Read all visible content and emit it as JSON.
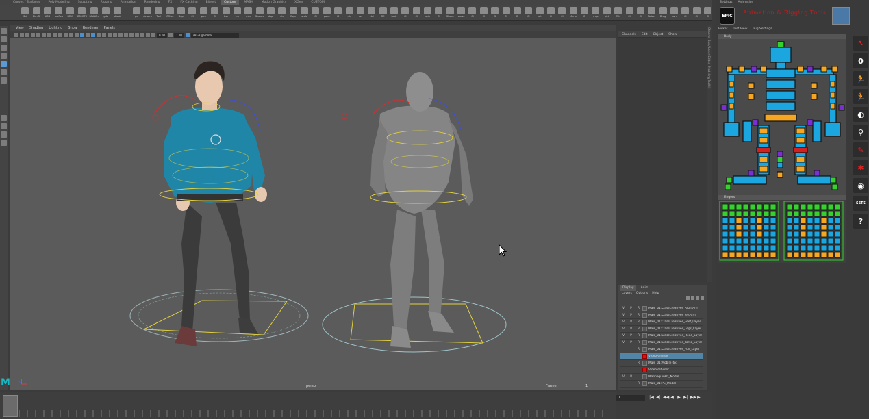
{
  "shelf_tabs": [
    "Curves / Surfaces",
    "Poly Modeling",
    "Sculpting",
    "Rigging",
    "Animation",
    "Rendering",
    "FX",
    "FX Caching",
    "Bifrost",
    "Custom",
    "MASH",
    "Motion Graphics",
    "XGen",
    "CUSTOM"
  ],
  "shelf_active_tab": "Custom",
  "shelf_group1": [
    "Sel",
    "BkmR",
    "U3D",
    "butRes",
    "BRX",
    "SMOOTH",
    "SCALEm",
    "gde",
    "bRest"
  ],
  "shelf_group2": [
    "ge",
    "deform",
    "Tool",
    "Offset",
    "Dupl",
    "Cl",
    "pick",
    "Cl",
    "bsn",
    "Lrn",
    "mirr",
    "Shapes",
    "dupl",
    "clu",
    "Expr",
    "scale",
    "Cl",
    "paint",
    "Cl",
    "mirr",
    "sel",
    "ctrl",
    "RC",
    "Lock",
    "Cl",
    "Cl",
    "skin",
    "Cl",
    "Shape",
    "curve",
    "Cl",
    "Cl",
    "Cl",
    "Cl",
    "Cl",
    "Cl",
    "rot",
    "Cl",
    "Cl",
    "Mirror",
    "Cl",
    "rngc",
    "pick",
    "CVs",
    "Cl",
    "Cl",
    "Select",
    "Drag",
    "bsh",
    "Cl",
    "Cl",
    "Cl"
  ],
  "viewport": {
    "menu": [
      "View",
      "Shading",
      "Lighting",
      "Show",
      "Renderer",
      "Panels"
    ],
    "field_1": "0.00",
    "field_2": "1.00",
    "colorspace": "sRGB gamma",
    "camera_label": "persp",
    "frame_label": "Frame:",
    "frame_value": "1"
  },
  "channel_box": {
    "tabs": [
      "Channels",
      "Edit",
      "Object",
      "Show"
    ],
    "side_tabs": [
      "Channel Box / Layer Editor",
      "Modeling Toolkit"
    ]
  },
  "layer_editor": {
    "tabs": [
      "Display",
      "Anim"
    ],
    "active_tab": "Display",
    "menu": [
      "Layers",
      "Options",
      "Help"
    ],
    "rows": [
      {
        "v": "V",
        "p": "P",
        "r": "R",
        "name": "Male_01:ClassCreatives_RightArm",
        "swatch": "gray",
        "selected": false
      },
      {
        "v": "V",
        "p": "P",
        "r": "R",
        "name": "Male_01:ClassCreatives_leftArm",
        "swatch": "gray",
        "selected": false
      },
      {
        "v": "V",
        "p": "P",
        "r": "R",
        "name": "Male_01:ClassCreatives_Feet_Layer",
        "swatch": "gray",
        "selected": false
      },
      {
        "v": "V",
        "p": "P",
        "r": "R",
        "name": "Male_01:ClassCreatives_Legs_Layer",
        "swatch": "gray",
        "selected": false
      },
      {
        "v": "V",
        "p": "P",
        "r": "R",
        "name": "Male_01:ClassCreatives_Head_Layer",
        "swatch": "gray",
        "selected": false
      },
      {
        "v": "V",
        "p": "P",
        "r": "R",
        "name": "Male_01:ClassCreatives_Torso_Layer",
        "swatch": "gray",
        "selected": false
      },
      {
        "v": "",
        "p": "",
        "r": "R",
        "name": "Male_01:ClassCreatives_Full_Layer",
        "swatch": "gray",
        "selected": false
      },
      {
        "v": "",
        "p": "",
        "r": "",
        "name": "VideoRefSide",
        "swatch": "red",
        "selected": true
      },
      {
        "v": "",
        "p": "",
        "r": "R",
        "name": "Male_01:Mobile_6k",
        "swatch": "gray",
        "selected": false
      },
      {
        "v": "",
        "p": "",
        "r": "",
        "name": "VideoRefFront",
        "swatch": "red",
        "selected": false
      },
      {
        "v": "V",
        "p": "P",
        "r": "",
        "name": "MannequinPC_Model",
        "swatch": "gray",
        "selected": false
      },
      {
        "v": "",
        "p": "",
        "r": "R",
        "name": "Male_01:PC_Model",
        "swatch": "gray",
        "selected": false
      }
    ]
  },
  "timeline": {
    "current_frame": "1",
    "buttons": [
      "|◀",
      "◀|",
      "◀◀",
      "◀",
      "▶",
      "▶|",
      "▶▶",
      "▶|"
    ]
  },
  "art": {
    "menu": [
      "Settings",
      "Animation"
    ],
    "logo_text": "EPIC",
    "title": "Animation & Rigging Tools",
    "tabs": [
      "Picker",
      "List View",
      "Rig Settings"
    ],
    "body_section": "Body",
    "fingers_section": "Fingers",
    "tool_labels": {
      "zero": "0",
      "sets": "SETS",
      "help": "?"
    }
  },
  "colors": {
    "rig_blue": "#1ba6e0",
    "rig_orange": "#f5a623",
    "rig_green": "#36d02f",
    "rig_purple": "#7a2fd0",
    "rig_red": "#d02020",
    "viewport_bg": "#5b5b5b",
    "selection": "#5285a6",
    "maya_teal": "#19b9c4"
  }
}
